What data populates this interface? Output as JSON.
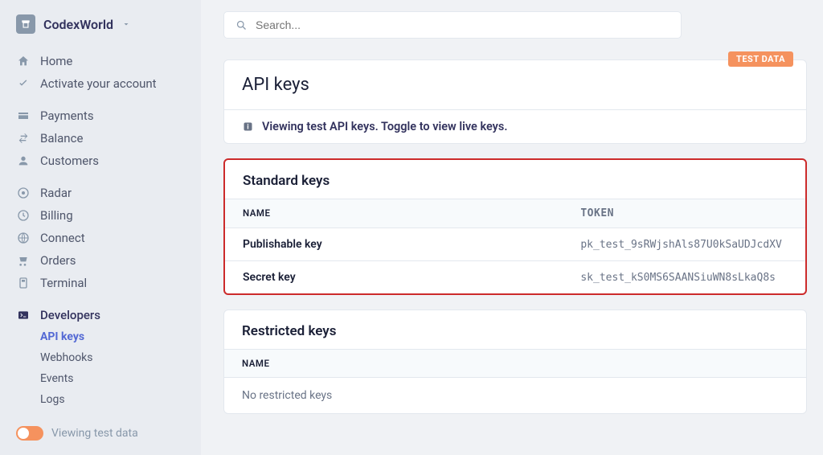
{
  "org": {
    "name": "CodexWorld"
  },
  "search": {
    "placeholder": "Search..."
  },
  "sidebar": {
    "group1": [
      {
        "label": "Home"
      },
      {
        "label": "Activate your account"
      }
    ],
    "group2": [
      {
        "label": "Payments"
      },
      {
        "label": "Balance"
      },
      {
        "label": "Customers"
      }
    ],
    "group3": [
      {
        "label": "Radar"
      },
      {
        "label": "Billing"
      },
      {
        "label": "Connect"
      },
      {
        "label": "Orders"
      },
      {
        "label": "Terminal"
      }
    ],
    "developers": {
      "label": "Developers"
    },
    "sub": [
      {
        "label": "API keys",
        "active": true
      },
      {
        "label": "Webhooks"
      },
      {
        "label": "Events"
      },
      {
        "label": "Logs"
      }
    ],
    "test_toggle": "Viewing test data"
  },
  "page": {
    "title": "API keys",
    "badge": "TEST DATA",
    "notice": "Viewing test API keys. Toggle to view live keys."
  },
  "standard": {
    "title": "Standard keys",
    "cols": {
      "name": "NAME",
      "token": "TOKEN"
    },
    "rows": [
      {
        "name": "Publishable key",
        "token": "pk_test_9sRWjshAls87U0kSaUDJcdXV"
      },
      {
        "name": "Secret key",
        "token": "sk_test_kS0MS6SAANSiuWN8sLkaQ8s"
      }
    ]
  },
  "restricted": {
    "title": "Restricted keys",
    "cols": {
      "name": "NAME"
    },
    "empty": "No restricted keys"
  }
}
